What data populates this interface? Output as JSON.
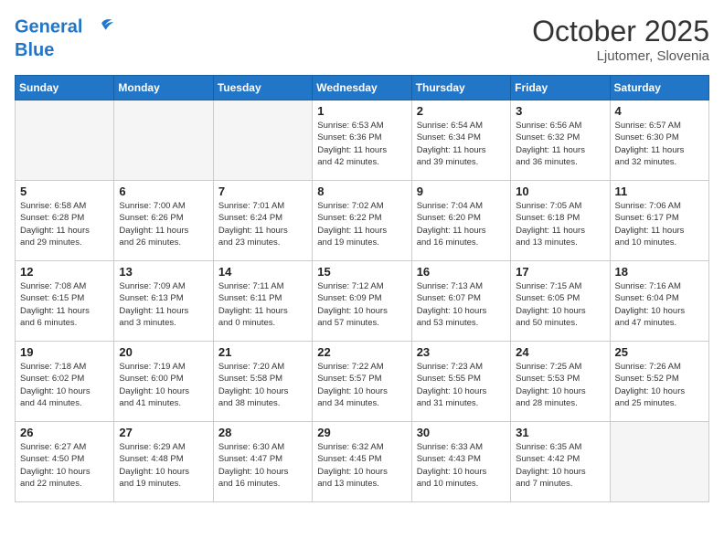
{
  "header": {
    "logo_line1": "General",
    "logo_line2": "Blue",
    "month": "October 2025",
    "location": "Ljutomer, Slovenia"
  },
  "days_of_week": [
    "Sunday",
    "Monday",
    "Tuesday",
    "Wednesday",
    "Thursday",
    "Friday",
    "Saturday"
  ],
  "weeks": [
    [
      {
        "day": "",
        "info": ""
      },
      {
        "day": "",
        "info": ""
      },
      {
        "day": "",
        "info": ""
      },
      {
        "day": "1",
        "info": "Sunrise: 6:53 AM\nSunset: 6:36 PM\nDaylight: 11 hours\nand 42 minutes."
      },
      {
        "day": "2",
        "info": "Sunrise: 6:54 AM\nSunset: 6:34 PM\nDaylight: 11 hours\nand 39 minutes."
      },
      {
        "day": "3",
        "info": "Sunrise: 6:56 AM\nSunset: 6:32 PM\nDaylight: 11 hours\nand 36 minutes."
      },
      {
        "day": "4",
        "info": "Sunrise: 6:57 AM\nSunset: 6:30 PM\nDaylight: 11 hours\nand 32 minutes."
      }
    ],
    [
      {
        "day": "5",
        "info": "Sunrise: 6:58 AM\nSunset: 6:28 PM\nDaylight: 11 hours\nand 29 minutes."
      },
      {
        "day": "6",
        "info": "Sunrise: 7:00 AM\nSunset: 6:26 PM\nDaylight: 11 hours\nand 26 minutes."
      },
      {
        "day": "7",
        "info": "Sunrise: 7:01 AM\nSunset: 6:24 PM\nDaylight: 11 hours\nand 23 minutes."
      },
      {
        "day": "8",
        "info": "Sunrise: 7:02 AM\nSunset: 6:22 PM\nDaylight: 11 hours\nand 19 minutes."
      },
      {
        "day": "9",
        "info": "Sunrise: 7:04 AM\nSunset: 6:20 PM\nDaylight: 11 hours\nand 16 minutes."
      },
      {
        "day": "10",
        "info": "Sunrise: 7:05 AM\nSunset: 6:18 PM\nDaylight: 11 hours\nand 13 minutes."
      },
      {
        "day": "11",
        "info": "Sunrise: 7:06 AM\nSunset: 6:17 PM\nDaylight: 11 hours\nand 10 minutes."
      }
    ],
    [
      {
        "day": "12",
        "info": "Sunrise: 7:08 AM\nSunset: 6:15 PM\nDaylight: 11 hours\nand 6 minutes."
      },
      {
        "day": "13",
        "info": "Sunrise: 7:09 AM\nSunset: 6:13 PM\nDaylight: 11 hours\nand 3 minutes."
      },
      {
        "day": "14",
        "info": "Sunrise: 7:11 AM\nSunset: 6:11 PM\nDaylight: 11 hours\nand 0 minutes."
      },
      {
        "day": "15",
        "info": "Sunrise: 7:12 AM\nSunset: 6:09 PM\nDaylight: 10 hours\nand 57 minutes."
      },
      {
        "day": "16",
        "info": "Sunrise: 7:13 AM\nSunset: 6:07 PM\nDaylight: 10 hours\nand 53 minutes."
      },
      {
        "day": "17",
        "info": "Sunrise: 7:15 AM\nSunset: 6:05 PM\nDaylight: 10 hours\nand 50 minutes."
      },
      {
        "day": "18",
        "info": "Sunrise: 7:16 AM\nSunset: 6:04 PM\nDaylight: 10 hours\nand 47 minutes."
      }
    ],
    [
      {
        "day": "19",
        "info": "Sunrise: 7:18 AM\nSunset: 6:02 PM\nDaylight: 10 hours\nand 44 minutes."
      },
      {
        "day": "20",
        "info": "Sunrise: 7:19 AM\nSunset: 6:00 PM\nDaylight: 10 hours\nand 41 minutes."
      },
      {
        "day": "21",
        "info": "Sunrise: 7:20 AM\nSunset: 5:58 PM\nDaylight: 10 hours\nand 38 minutes."
      },
      {
        "day": "22",
        "info": "Sunrise: 7:22 AM\nSunset: 5:57 PM\nDaylight: 10 hours\nand 34 minutes."
      },
      {
        "day": "23",
        "info": "Sunrise: 7:23 AM\nSunset: 5:55 PM\nDaylight: 10 hours\nand 31 minutes."
      },
      {
        "day": "24",
        "info": "Sunrise: 7:25 AM\nSunset: 5:53 PM\nDaylight: 10 hours\nand 28 minutes."
      },
      {
        "day": "25",
        "info": "Sunrise: 7:26 AM\nSunset: 5:52 PM\nDaylight: 10 hours\nand 25 minutes."
      }
    ],
    [
      {
        "day": "26",
        "info": "Sunrise: 6:27 AM\nSunset: 4:50 PM\nDaylight: 10 hours\nand 22 minutes."
      },
      {
        "day": "27",
        "info": "Sunrise: 6:29 AM\nSunset: 4:48 PM\nDaylight: 10 hours\nand 19 minutes."
      },
      {
        "day": "28",
        "info": "Sunrise: 6:30 AM\nSunset: 4:47 PM\nDaylight: 10 hours\nand 16 minutes."
      },
      {
        "day": "29",
        "info": "Sunrise: 6:32 AM\nSunset: 4:45 PM\nDaylight: 10 hours\nand 13 minutes."
      },
      {
        "day": "30",
        "info": "Sunrise: 6:33 AM\nSunset: 4:43 PM\nDaylight: 10 hours\nand 10 minutes."
      },
      {
        "day": "31",
        "info": "Sunrise: 6:35 AM\nSunset: 4:42 PM\nDaylight: 10 hours\nand 7 minutes."
      },
      {
        "day": "",
        "info": ""
      }
    ]
  ]
}
